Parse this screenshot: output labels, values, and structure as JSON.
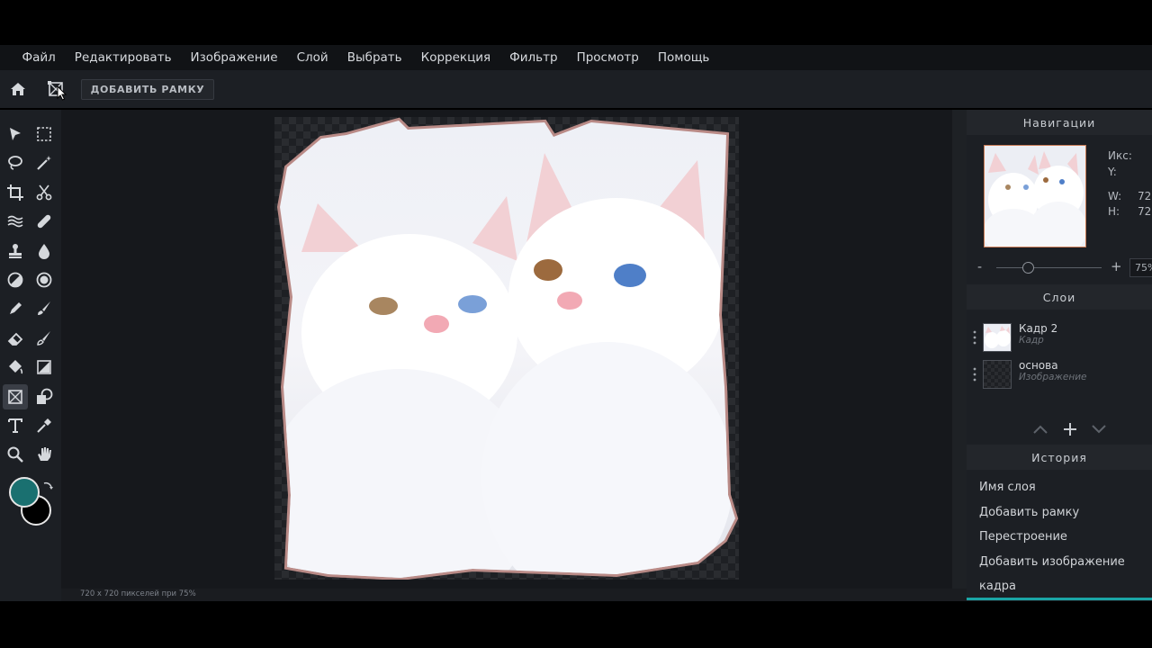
{
  "menu": [
    "Файл",
    "Редактировать",
    "Изображение",
    "Слой",
    "Выбрать",
    "Коррекция",
    "Фильтр",
    "Просмотр",
    "Помощь"
  ],
  "toolbar": {
    "add_frame_label": "ДОБАВИТЬ РАМКУ"
  },
  "colors": {
    "foreground": "#1a7070",
    "background": "#000000",
    "accent": "#1aa5a5"
  },
  "status": {
    "text": "720 x 720 пикселей при 75%"
  },
  "navigation": {
    "title": "Навигации",
    "x_label": "Икс:",
    "y_label": "Y:",
    "w_label": "W:",
    "w_value": "72",
    "h_label": "H:",
    "h_value": "72",
    "zoom_minus": "-",
    "zoom_plus": "+",
    "zoom_value": "75%"
  },
  "layers": {
    "title": "Слои",
    "items": [
      {
        "name": "Кадр 2",
        "type": "Кадр"
      },
      {
        "name": "основа",
        "type": "Изображение"
      }
    ]
  },
  "history": {
    "title": "История",
    "items": [
      "Имя слоя",
      "Добавить рамку",
      "Перестроение",
      "Добавить изображение",
      "кадра"
    ]
  },
  "icons": {
    "home": "home-icon",
    "frame": "frame-icon",
    "tools": [
      "select-arrow-icon",
      "marquee-icon",
      "lasso-icon",
      "magic-wand-icon",
      "crop-icon",
      "scissors-icon",
      "liquify-icon",
      "healing-icon",
      "stamp-icon",
      "drop-icon",
      "dodge-icon",
      "sponge-icon",
      "pencil-icon",
      "brush-icon",
      "eraser-icon",
      "replace-color-icon",
      "bucket-icon",
      "gradient-icon",
      "frame-tool-icon",
      "shape-icon",
      "text-icon",
      "eyedropper-icon",
      "zoom-icon",
      "hand-icon"
    ]
  }
}
